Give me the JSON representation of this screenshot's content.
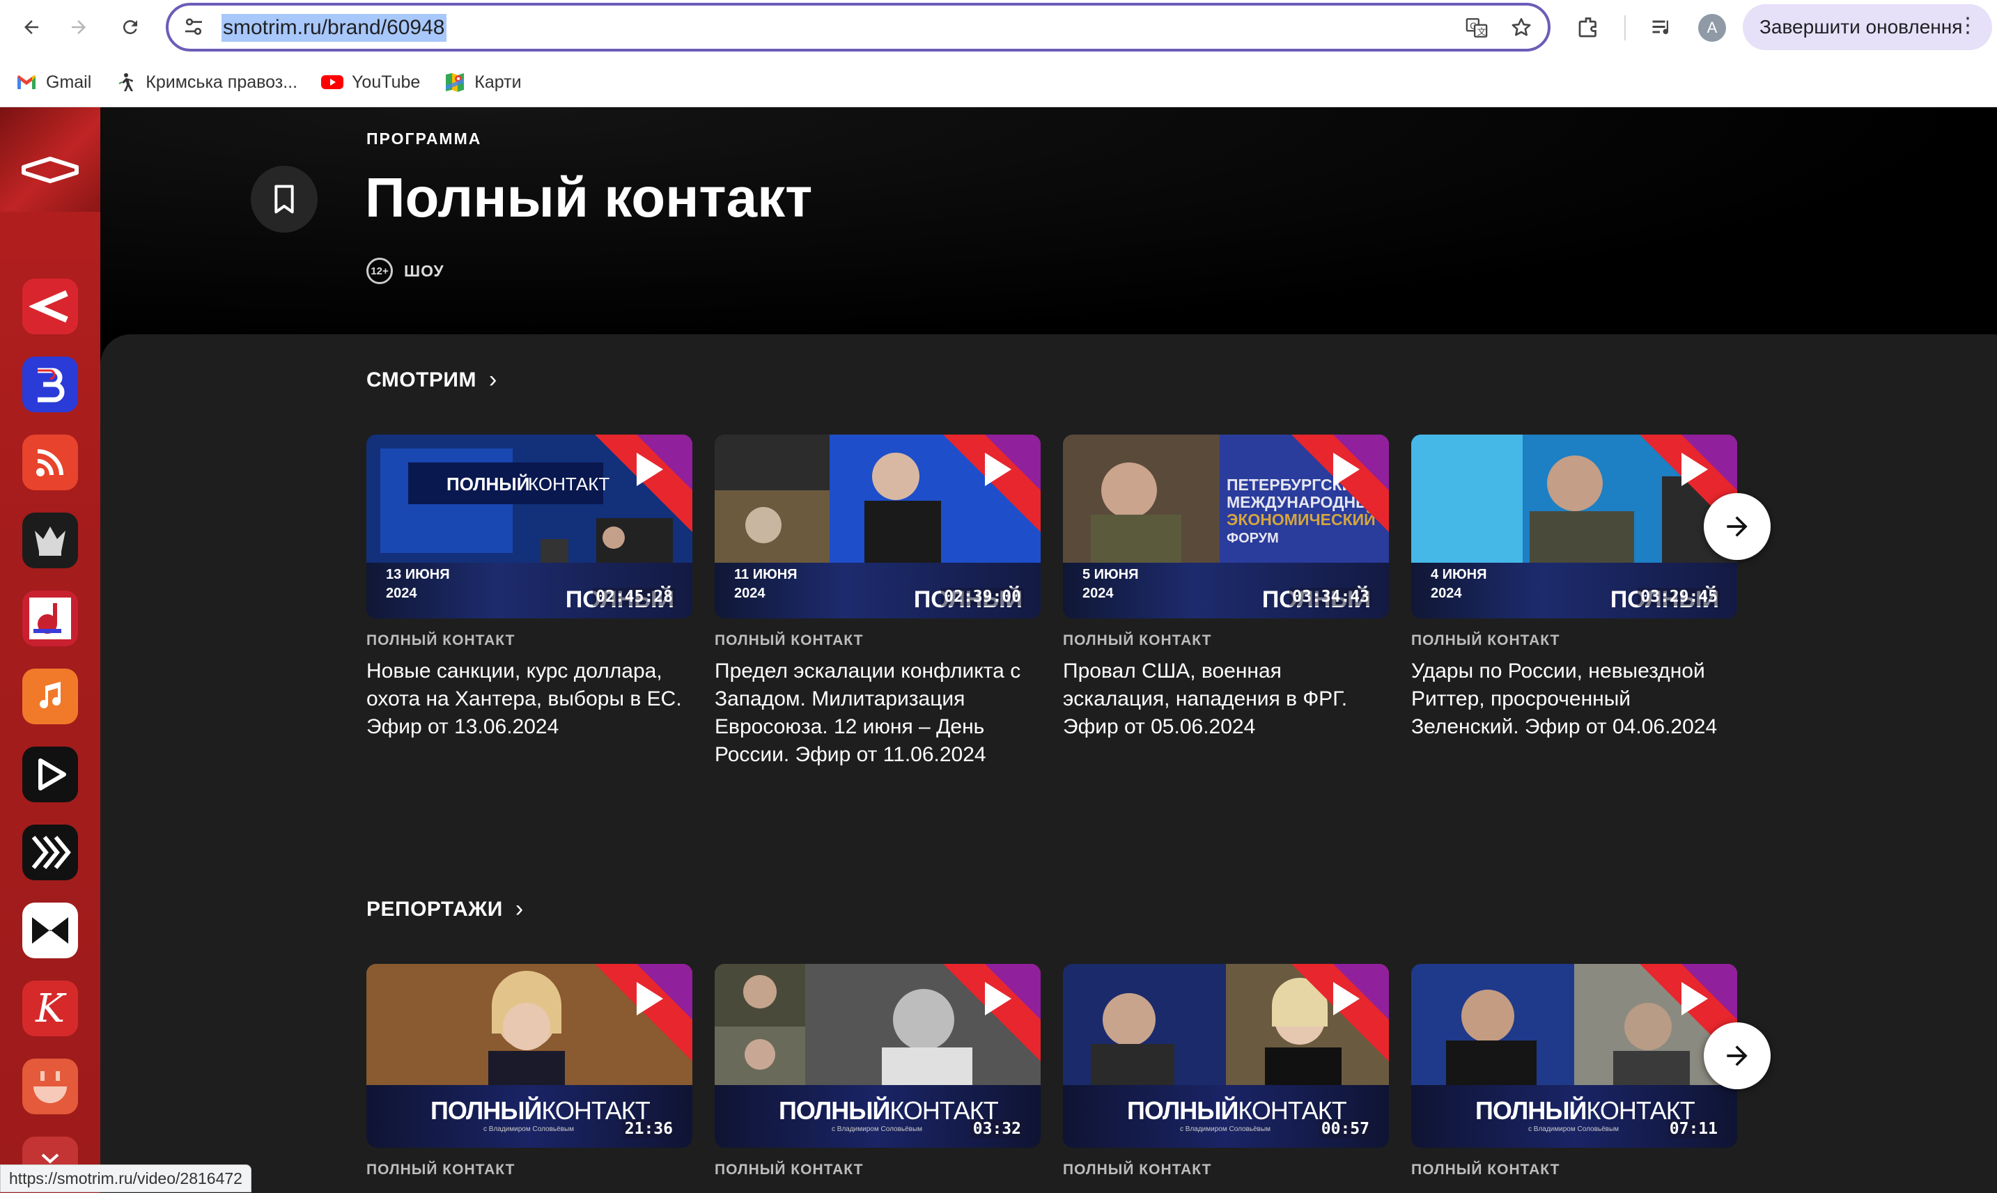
{
  "browser": {
    "url": "smotrim.ru/brand/60948",
    "update_button": "Завершити оновлення",
    "avatar_letter": "A",
    "bookmarks": [
      {
        "label": "Gmail",
        "icon": "gmail-icon"
      },
      {
        "label": "Кримська правоз...",
        "icon": "crimea-rights-icon"
      },
      {
        "label": "YouTube",
        "icon": "youtube-icon"
      },
      {
        "label": "Карти",
        "icon": "maps-icon"
      }
    ],
    "status_url": "https://smotrim.ru/video/2816472"
  },
  "rail": {
    "apps": [
      {
        "name": "smotrim-app",
        "color": "#d9262e"
      },
      {
        "name": "vesti-app",
        "color": "#2a3bd8"
      },
      {
        "name": "podcast-app",
        "color": "#e8432c"
      },
      {
        "name": "kultura-app",
        "color": "#1c1c1c"
      },
      {
        "name": "music-app",
        "color": "#c92030"
      },
      {
        "name": "itunes-app",
        "color": "#f07a2a"
      },
      {
        "name": "play-app",
        "color": "#111111"
      },
      {
        "name": "forward-app",
        "color": "#111111"
      },
      {
        "name": "mail-app",
        "color": "#ffffff"
      },
      {
        "name": "k-app",
        "color": "#d62a2a"
      },
      {
        "name": "smile-app",
        "color": "#e45a3a"
      }
    ]
  },
  "hero": {
    "eyebrow": "ПРОГРАММА",
    "title": "Полный контакт",
    "age": "12+",
    "genre": "ШОУ"
  },
  "sections": [
    {
      "title": "СМОТРИМ",
      "cards": [
        {
          "kicker": "ПОЛНЫЙ КОНТАКТ",
          "title": "Новые санкции, курс доллара, охота на Хантера, выборы в ЕС. Эфир от 13.06.2024",
          "date_day": "13 ИЮНЯ",
          "date_year": "2024",
          "duration": "02:45:28"
        },
        {
          "kicker": "ПОЛНЫЙ КОНТАКТ",
          "title": "Предел эскалации конфликта с Западом. Милитаризация Евросоюза. 12 июня – День России. Эфир от 11.06.2024",
          "date_day": "11 ИЮНЯ",
          "date_year": "2024",
          "duration": "02:39:00"
        },
        {
          "kicker": "ПОЛНЫЙ КОНТАКТ",
          "title": "Провал США, военная эскалация, нападения в ФРГ. Эфир от 05.06.2024",
          "date_day": "5 ИЮНЯ",
          "date_year": "2024",
          "duration": "03:34:43"
        },
        {
          "kicker": "ПОЛНЫЙ КОНТАКТ",
          "title": "Удары по России, невыездной Риттер, просроченный Зеленский. Эфир от 04.06.2024",
          "date_day": "4 ИЮНЯ",
          "date_year": "2024",
          "duration": "03:29:45"
        }
      ]
    },
    {
      "title": "РЕПОРТАЖИ",
      "cards": [
        {
          "kicker": "ПОЛНЫЙ КОНТАКТ",
          "duration": "21:36"
        },
        {
          "kicker": "ПОЛНЫЙ КОНТАКТ",
          "duration": "03:32"
        },
        {
          "kicker": "ПОЛНЫЙ КОНТАКТ",
          "duration": "00:57"
        },
        {
          "kicker": "ПОЛНЫЙ КОНТАКТ",
          "duration": "07:11"
        }
      ]
    }
  ],
  "thumb_logo": {
    "first": "ПОЛНЫЙ",
    "second": "КОНТАКТ",
    "sub": "с Владимиром Соловьёвым",
    "short": "ПОЛНЫЙ"
  },
  "scene_text": {
    "forum": [
      "ПЕТЕРБУРГСКИЙ",
      "МЕЖДУНАРОДНЫЙ",
      "ЭКОНОМИЧЕСКИЙ",
      "ФОРУМ"
    ]
  },
  "colors": {
    "accent": "#e8262d",
    "rail": "#a51c1c",
    "panel": "#1e1e1e",
    "brandbar": "#1d2b6e"
  }
}
